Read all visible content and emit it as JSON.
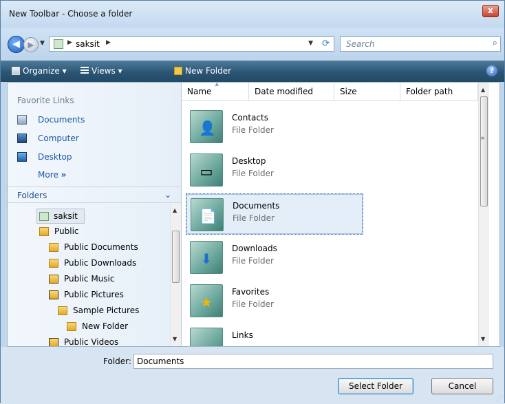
{
  "window": {
    "title": "New Toolbar - Choose a folder",
    "close_label": "x"
  },
  "address": {
    "crumbs": [
      "saksit"
    ]
  },
  "search": {
    "placeholder": "Search"
  },
  "toolbar": {
    "organize": "Organize",
    "views": "Views",
    "new_folder": "New Folder"
  },
  "favorites": {
    "title": "Favorite Links",
    "items": [
      {
        "label": "Documents",
        "icon": "documents-icon"
      },
      {
        "label": "Computer",
        "icon": "computer-icon"
      },
      {
        "label": "Desktop",
        "icon": "desktop-icon"
      }
    ],
    "more": "More"
  },
  "folders": {
    "header": "Folders",
    "tree": [
      {
        "label": "saksit",
        "icon": "user-folder-icon",
        "selected": true
      },
      {
        "label": "Public",
        "icon": "folder-icon"
      },
      {
        "label": "Public Documents",
        "icon": "folder-icon"
      },
      {
        "label": "Public Downloads",
        "icon": "folder-icon"
      },
      {
        "label": "Public Music",
        "icon": "music-folder-icon"
      },
      {
        "label": "Public Pictures",
        "icon": "pictures-folder-icon"
      },
      {
        "label": "Sample Pictures",
        "icon": "folder-icon"
      },
      {
        "label": "New Folder",
        "icon": "folder-icon"
      },
      {
        "label": "Public Videos",
        "icon": "videos-folder-icon"
      }
    ]
  },
  "columns": [
    "Name",
    "Date modified",
    "Size",
    "Folder path"
  ],
  "files": [
    {
      "name": "Contacts",
      "type": "File Folder",
      "icon": "contacts-folder-icon",
      "selected": false
    },
    {
      "name": "Desktop",
      "type": "File Folder",
      "icon": "desktop-folder-icon",
      "selected": false
    },
    {
      "name": "Documents",
      "type": "File Folder",
      "icon": "documents-folder-icon",
      "selected": true
    },
    {
      "name": "Downloads",
      "type": "File Folder",
      "icon": "downloads-folder-icon",
      "selected": false
    },
    {
      "name": "Favorites",
      "type": "File Folder",
      "icon": "favorites-folder-icon",
      "selected": false
    },
    {
      "name": "Links",
      "type": "",
      "icon": "links-folder-icon",
      "selected": false
    }
  ],
  "footer": {
    "folder_label": "Folder:",
    "folder_value": "Documents",
    "select_button": "Select Folder",
    "cancel_button": "Cancel"
  },
  "colors": {
    "toolbar": "#2b5574",
    "link": "#1a5aa6",
    "selection": "#e4eef9"
  }
}
